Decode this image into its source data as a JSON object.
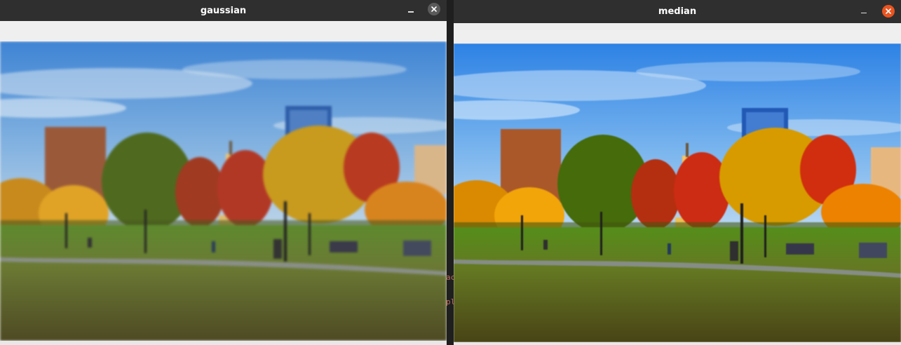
{
  "windows": [
    {
      "title": "gaussian",
      "buttons": {
        "minimize": "–"
      }
    },
    {
      "title": "median",
      "buttons": {
        "minimize": "–"
      }
    }
  ],
  "background_terminal": {
    "line1": "ac",
    "line2": "pl"
  },
  "icons": {
    "close": "close-icon",
    "minimize": "minimize-icon"
  },
  "colors": {
    "titlebar": "#2f2f2f",
    "close_inactive": "#5b5b5b",
    "close_active": "#e95420",
    "toolbar": "#efefef"
  }
}
